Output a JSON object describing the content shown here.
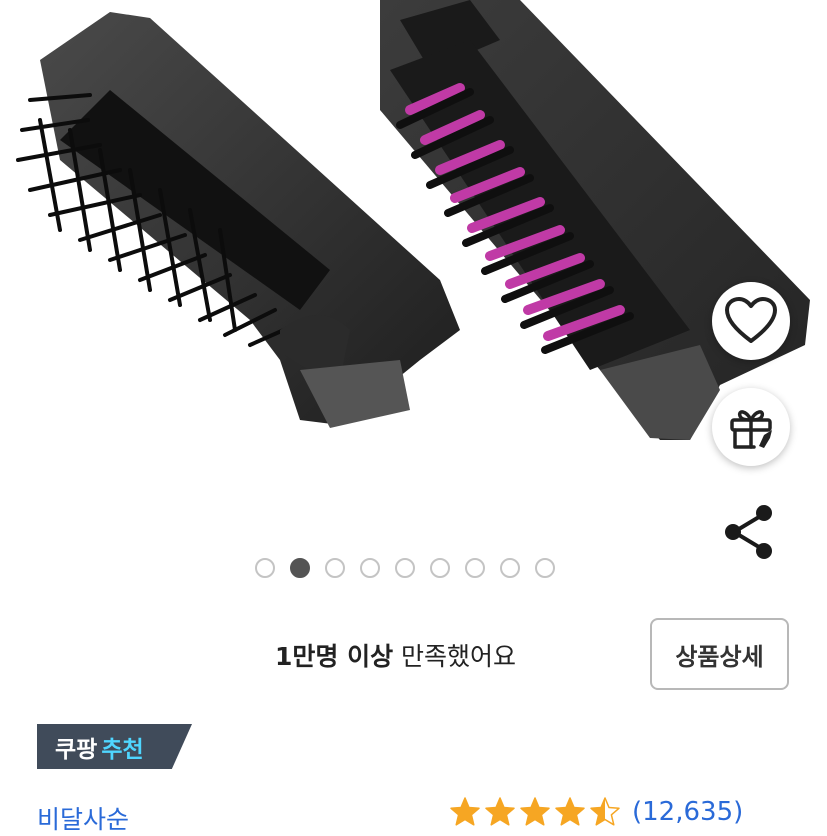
{
  "gallery": {
    "image_alt": "hair dryer brush attachments",
    "total_images": 9,
    "active_index": 1
  },
  "actions": {
    "wishlist_icon": "heart-outline-icon",
    "gift_icon": "gift-icon",
    "share_icon": "share-icon"
  },
  "review_summary": {
    "bold_text": "1만명 이상",
    "rest_text": " 만족했어요",
    "detail_button": "상품상세"
  },
  "recommendation_badge": {
    "brand": "쿠팡",
    "label": "추천",
    "accent_color": "#4fd6ff"
  },
  "seller": {
    "name": "비달사순"
  },
  "rating": {
    "stars": 4.5,
    "count": "(12,635)",
    "star_color": "#f6a623"
  }
}
